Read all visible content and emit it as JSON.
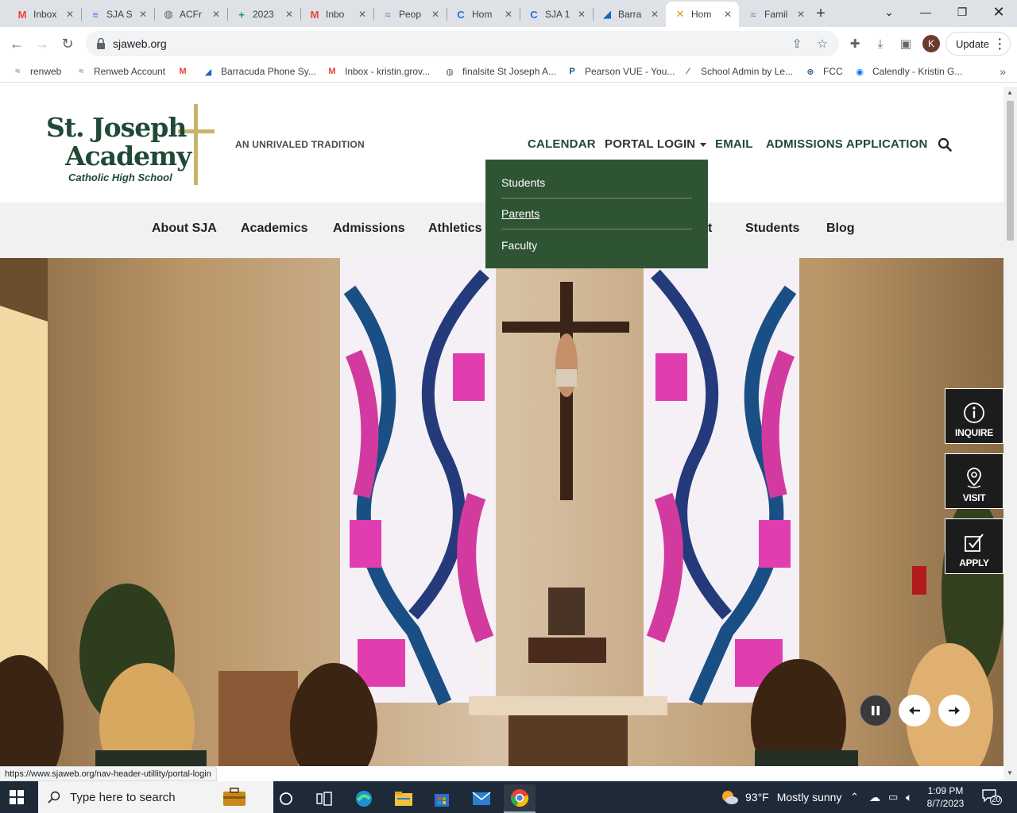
{
  "browser": {
    "tabs": [
      {
        "title": "Inbox",
        "icon": "gmail-icon",
        "color": "#ea4335",
        "glyph": "M"
      },
      {
        "title": "SJA S",
        "icon": "google-docs-icon",
        "color": "#4285f4",
        "glyph": "≡"
      },
      {
        "title": "ACFr",
        "icon": "globe-icon",
        "color": "#5f6368",
        "glyph": "◍"
      },
      {
        "title": "2023",
        "icon": "google-sheets-icon",
        "color": "#0f9d58",
        "glyph": "+"
      },
      {
        "title": "Inbo",
        "icon": "gmail-icon",
        "color": "#ea4335",
        "glyph": "M"
      },
      {
        "title": "Peop",
        "icon": "renweb-icon",
        "color": "#7a9cc6",
        "glyph": "≈"
      },
      {
        "title": "Hom",
        "icon": "canvas-c-icon",
        "color": "#1a73e8",
        "glyph": "C"
      },
      {
        "title": "SJA 1",
        "icon": "canvas-c-icon",
        "color": "#1a73e8",
        "glyph": "C"
      },
      {
        "title": "Barra",
        "icon": "barracuda-icon",
        "color": "#1565c0",
        "glyph": "◢"
      },
      {
        "title": "Hom",
        "icon": "sja-x-icon",
        "color": "#c9a227",
        "glyph": "✕"
      },
      {
        "title": "Famil",
        "icon": "renweb-icon",
        "color": "#7a9cc6",
        "glyph": "≈"
      }
    ],
    "active_tab": 9,
    "url": "sjaweb.org",
    "update_label": "Update",
    "profile_initial": "K",
    "bookmarks": [
      {
        "label": "renweb",
        "icon": "renweb-icon",
        "glyph": "≈",
        "color": "#7a9cc6"
      },
      {
        "label": "Renweb Account",
        "icon": "renweb-icon",
        "glyph": "≈",
        "color": "#7a9cc6"
      },
      {
        "label": "",
        "icon": "gmail-icon",
        "glyph": "M",
        "color": "#ea4335"
      },
      {
        "label": "Barracuda Phone Sy...",
        "icon": "barracuda-icon",
        "glyph": "◢",
        "color": "#1565c0"
      },
      {
        "label": "Inbox - kristin.grov...",
        "icon": "gmail-icon",
        "glyph": "M",
        "color": "#ea4335"
      },
      {
        "label": "finalsite St Joseph A...",
        "icon": "globe-icon",
        "glyph": "◍",
        "color": "#5f6368"
      },
      {
        "label": "Pearson VUE - You...",
        "icon": "pearson-icon",
        "glyph": "P",
        "color": "#0a5c8a"
      },
      {
        "label": "School Admin by Le...",
        "icon": "pen-icon",
        "glyph": "⁄",
        "color": "#555"
      },
      {
        "label": "FCC",
        "icon": "fcc-icon",
        "glyph": "⊕",
        "color": "#3c5a8a"
      },
      {
        "label": "Calendly - Kristin G...",
        "icon": "calendly-icon",
        "glyph": "◉",
        "color": "#006bff"
      }
    ],
    "status_url": "https://www.sjaweb.org/nav-header-utillity/portal-login"
  },
  "site": {
    "logo_line1": "St. Joseph",
    "logo_line2": "Academy",
    "logo_line3": "Catholic High School",
    "tagline": "AN UNRIVALED TRADITION",
    "utility": {
      "calendar": "CALENDAR",
      "portal": "PORTAL LOGIN",
      "email": "EMAIL",
      "admissions": "ADMISSIONS APPLICATION"
    },
    "nav": {
      "about": "About SJA",
      "academics": "Academics",
      "admissions": "Admissions",
      "athletics": "Athletics",
      "hidden_tail": "t",
      "students": "Students",
      "blog": "Blog"
    },
    "portal_dropdown": [
      "Students",
      "Parents",
      "Faculty"
    ],
    "portal_hovered": "Parents",
    "cta": {
      "inquire": "INQUIRE",
      "visit": "VISIT",
      "apply": "APPLY"
    },
    "colors": {
      "brand_green": "#1f4a35",
      "dropdown_green": "#2f5434",
      "gold": "#c9b469"
    }
  },
  "taskbar": {
    "search_placeholder": "Type here to search",
    "weather_temp": "93°F",
    "weather_text": "Mostly sunny",
    "time": "1:09 PM",
    "date": "8/7/2023",
    "notification_count": "20"
  }
}
